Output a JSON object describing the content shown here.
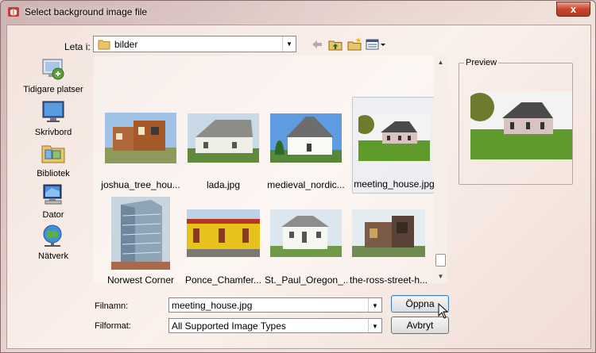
{
  "window": {
    "title": "Select background image file",
    "close_label": "x"
  },
  "lookin": {
    "label": "Leta i:",
    "value": "bilder"
  },
  "toolbar": {
    "back_icon": "back-arrow-icon",
    "up_icon": "up-folder-icon",
    "new_folder_icon": "new-folder-icon",
    "view_icon": "view-menu-icon"
  },
  "places": [
    {
      "label": "Tidigare platser",
      "icon": "recent-places-icon"
    },
    {
      "label": "Skrivbord",
      "icon": "desktop-icon"
    },
    {
      "label": "Bibliotek",
      "icon": "libraries-icon"
    },
    {
      "label": "Dator",
      "icon": "computer-icon"
    },
    {
      "label": "Nätverk",
      "icon": "network-icon"
    }
  ],
  "files": [
    {
      "name": "joshua_tree_hou...",
      "thumb": "modern-house"
    },
    {
      "name": "lada.jpg",
      "thumb": "barn"
    },
    {
      "name": "medieval_nordic...",
      "thumb": "white-church"
    },
    {
      "name": "meeting_house.jpg",
      "thumb": "meeting-house",
      "selected": true
    },
    {
      "name": "Norwest Corner",
      "thumb": "glass-tower"
    },
    {
      "name": "Ponce_Chamfer...",
      "thumb": "yellow-house"
    },
    {
      "name": "St._Paul_Oregon_...",
      "thumb": "white-church-2"
    },
    {
      "name": "the-ross-street-h...",
      "thumb": "brick-house"
    }
  ],
  "preview": {
    "label": "Preview"
  },
  "filename": {
    "label": "Filnamn:",
    "value": "meeting_house.jpg"
  },
  "filetype": {
    "label": "Filformat:",
    "value": "All Supported Image Types"
  },
  "buttons": {
    "open": "Öppna",
    "cancel": "Avbryt"
  },
  "colors": {
    "title_close": "#c8452e",
    "selection": "#d7e4f7",
    "default_button_border": "#3c7fb1"
  }
}
